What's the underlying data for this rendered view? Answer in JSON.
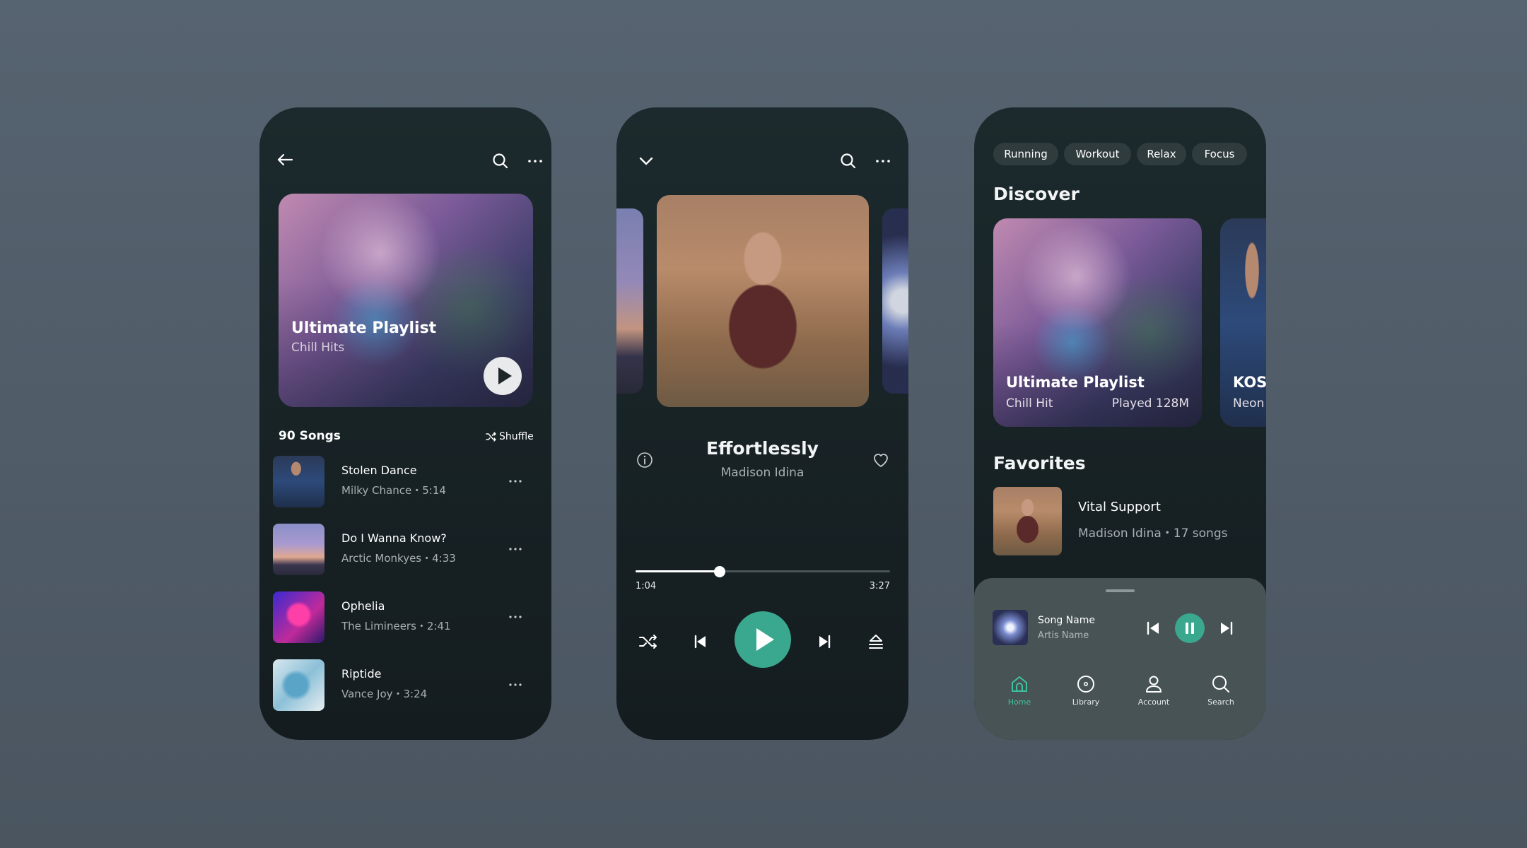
{
  "colors": {
    "accent": "#3aa88e",
    "background": "#4f5b66",
    "phone_bg": "#182326"
  },
  "playlist_screen": {
    "back_icon": "arrow-left-icon",
    "hero": {
      "title": "Ultimate Playlist",
      "subtitle": "Chill Hits"
    },
    "song_count": "90 Songs",
    "shuffle_label": "Shuffle",
    "songs": [
      {
        "title": "Stolen Dance",
        "meta": "Milky Chance・5:14"
      },
      {
        "title": "Do I Wanna Know?",
        "meta": "Arctic Monkyes・4:33"
      },
      {
        "title": "Ophelia",
        "meta": "The Limineers・2:41"
      },
      {
        "title": "Riptide",
        "meta": "Vance Joy・3:24"
      }
    ]
  },
  "player_screen": {
    "track_title": "Effortlessly",
    "artist": "Madison Idina",
    "elapsed": "1:04",
    "duration": "3:27",
    "progress": 0.33
  },
  "discover_screen": {
    "chips": [
      "Running",
      "Workout",
      "Relax",
      "Focus"
    ],
    "discover_heading": "Discover",
    "cards": [
      {
        "title": "Ultimate Playlist",
        "subtitle": "Chill Hit",
        "plays": "Played 128M"
      },
      {
        "title": "KOSI",
        "subtitle": "Neon"
      }
    ],
    "favorites_heading": "Favorites",
    "favorite": {
      "title": "Vital Support",
      "meta": "Madison Idina・17 songs"
    },
    "mini_player": {
      "song": "Song Name",
      "artist": "Artis Name"
    },
    "nav": [
      {
        "label": "Home",
        "icon": "home-icon",
        "active": true
      },
      {
        "label": "Library",
        "icon": "library-icon",
        "active": false
      },
      {
        "label": "Account",
        "icon": "account-icon",
        "active": false
      },
      {
        "label": "Search",
        "icon": "search-icon",
        "active": false
      }
    ]
  }
}
